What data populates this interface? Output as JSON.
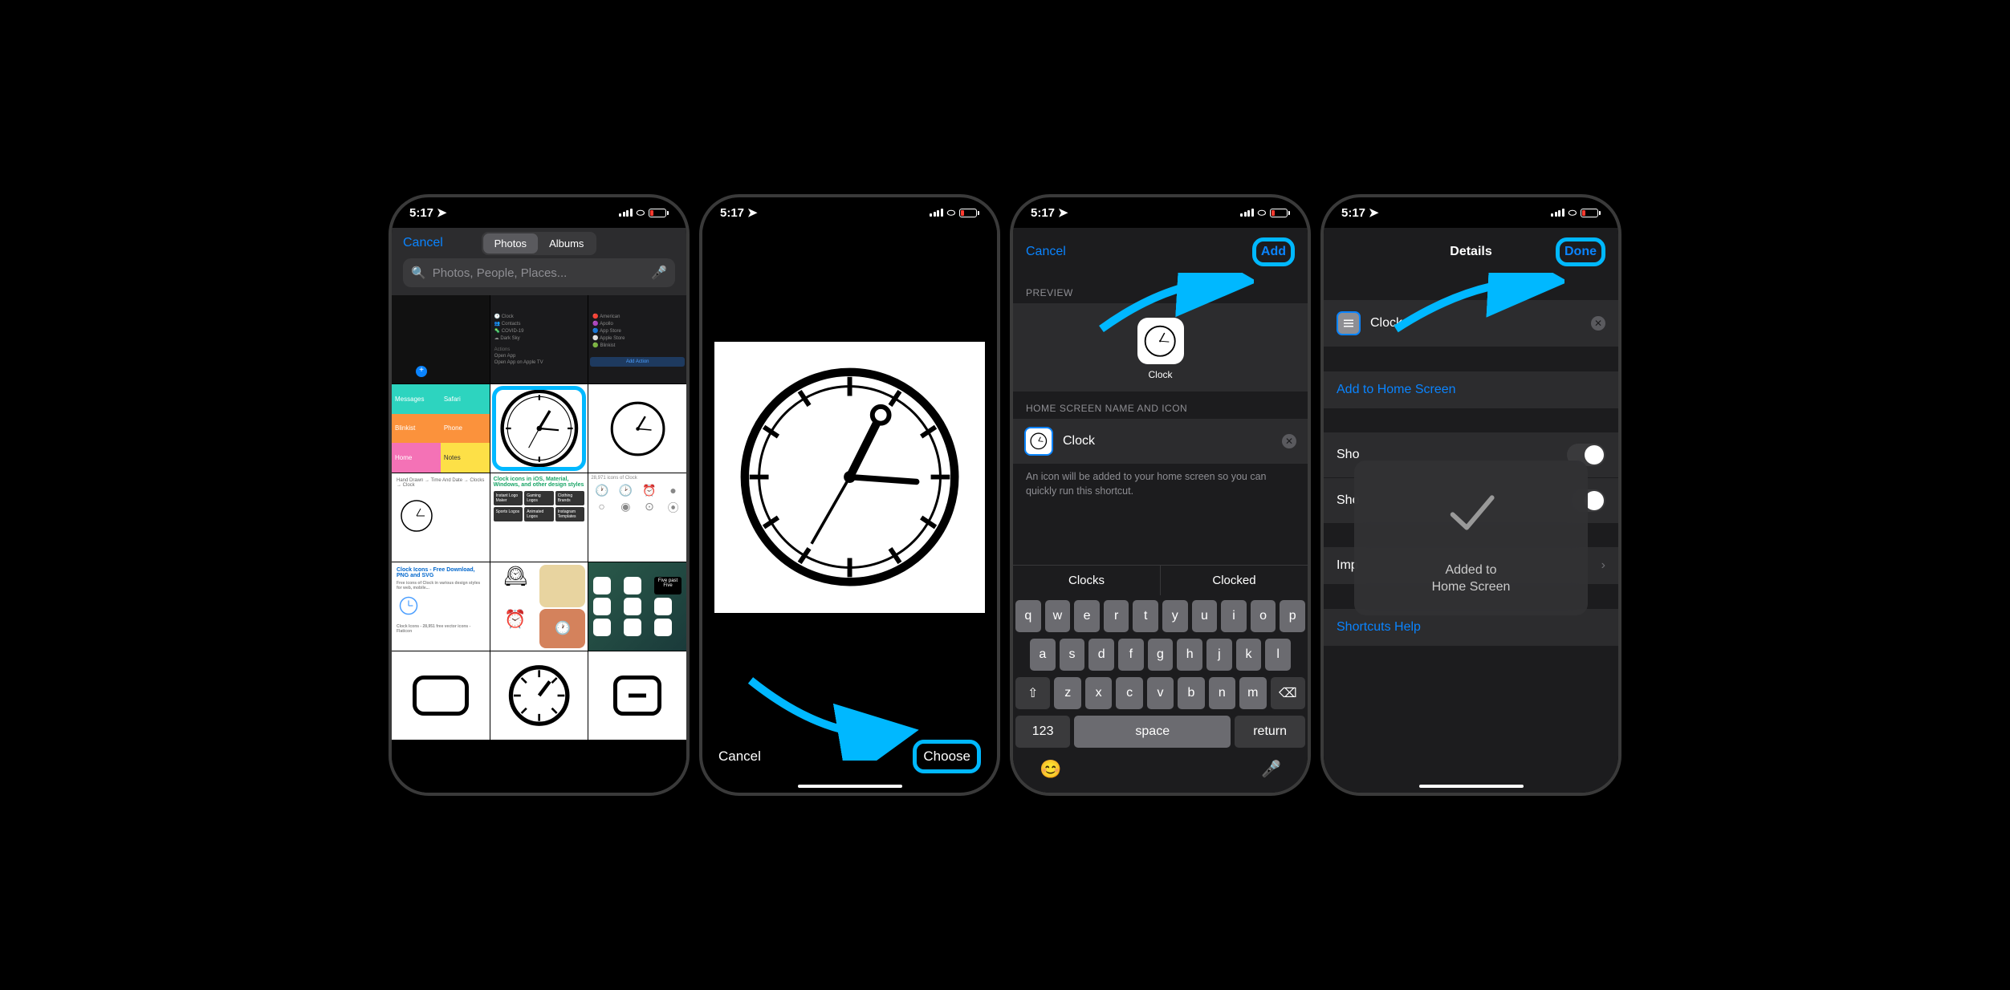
{
  "status": {
    "time": "5:17",
    "location_arrow": "↗"
  },
  "screen1": {
    "cancel": "Cancel",
    "seg_photos": "Photos",
    "seg_albums": "Albums",
    "search_placeholder": "Photos, People, Places...",
    "thumb_labels": {
      "messages": "Messages",
      "safari": "Safari",
      "blinkist": "Blinkist",
      "phone": "Phone",
      "home": "Home",
      "notes": "Notes",
      "clock_title": "Clock icons in iOS, Material, Windows, and other design styles",
      "icons8_count": "28,971 icons of Clock",
      "hand_drawn": "Hand Drawn → Time And Date → Clocks → Clock",
      "dl_title": "Clock Icons - Free Download, PNG and SVG",
      "flaticon": "Clock Icons - 28,951 free vector icons - Flaticon",
      "five_past": "Five past Five",
      "instant": "Instant Logo Maker",
      "gaming": "Gaming Logos",
      "clothing": "Clothing Brands",
      "sports": "Sports Logos",
      "animated": "Animated Logos",
      "insta": "Instagram Templates",
      "actions": "Actions",
      "open_app": "Open App",
      "open_tv": "Open App on Apple TV",
      "add_action": "Add Action"
    }
  },
  "screen2": {
    "cancel": "Cancel",
    "choose": "Choose"
  },
  "screen3": {
    "cancel": "Cancel",
    "add": "Add",
    "preview_label": "PREVIEW",
    "app_name": "Clock",
    "section_label": "HOME SCREEN NAME AND ICON",
    "input_value": "Clock",
    "hint": "An icon will be added to your home screen so you can quickly run this shortcut.",
    "suggestions": [
      "Clocks",
      "Clocked"
    ],
    "keyboard": {
      "row1": [
        "q",
        "w",
        "e",
        "r",
        "t",
        "y",
        "u",
        "i",
        "o",
        "p"
      ],
      "row2": [
        "a",
        "s",
        "d",
        "f",
        "g",
        "h",
        "j",
        "k",
        "l"
      ],
      "row3": [
        "z",
        "x",
        "c",
        "v",
        "b",
        "n",
        "m"
      ],
      "num": "123",
      "space": "space",
      "return": "return"
    }
  },
  "screen4": {
    "title": "Details",
    "done": "Done",
    "shortcut_name": "Clock",
    "add_home": "Add to Home Screen",
    "show1": "Sho",
    "show2": "Sho",
    "import": "Imp",
    "help": "Shortcuts Help",
    "overlay_text": "Added to\nHome Screen"
  }
}
